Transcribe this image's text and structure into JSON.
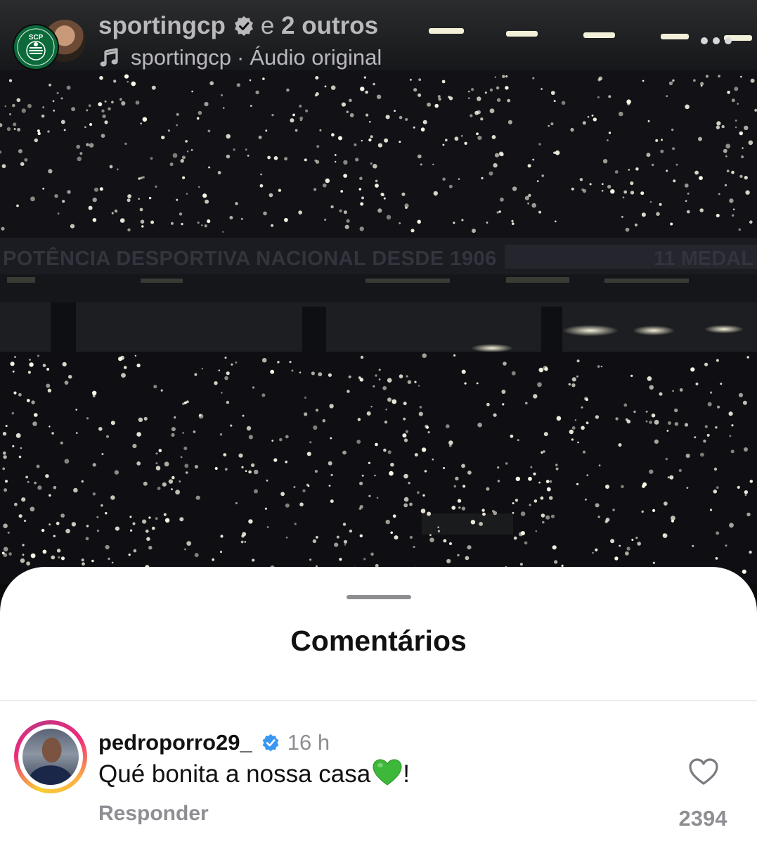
{
  "reel": {
    "author": "sportingcp",
    "collaborators_prefix": "e",
    "collaborators_count": "2 outros",
    "audio_user": "sportingcp",
    "audio_separator": "·",
    "audio_label": "Áudio original",
    "logo_text": "SCP",
    "banner_left": "POTÊNCIA DESPORTIVA NACIONAL DESDE 1906",
    "banner_right": "11 MEDAL",
    "icons": {
      "music": "music-note-icon",
      "verified": "verified-badge-icon",
      "more": "more-options-icon"
    }
  },
  "comments_sheet": {
    "title": "Comentários",
    "comments": [
      {
        "username": "pedroporro29_",
        "time": "16 h",
        "text": "Qué bonita a nossa casa",
        "text_suffix": "!",
        "reply_label": "Responder",
        "likes": "2394"
      }
    ]
  },
  "colors": {
    "sheet_bg": "#ffffff",
    "verified_blue": "#3897f0",
    "secondary_text": "#8e8e93",
    "sporting_green": "#0c6a3a",
    "heart_green": "#3db83a"
  }
}
